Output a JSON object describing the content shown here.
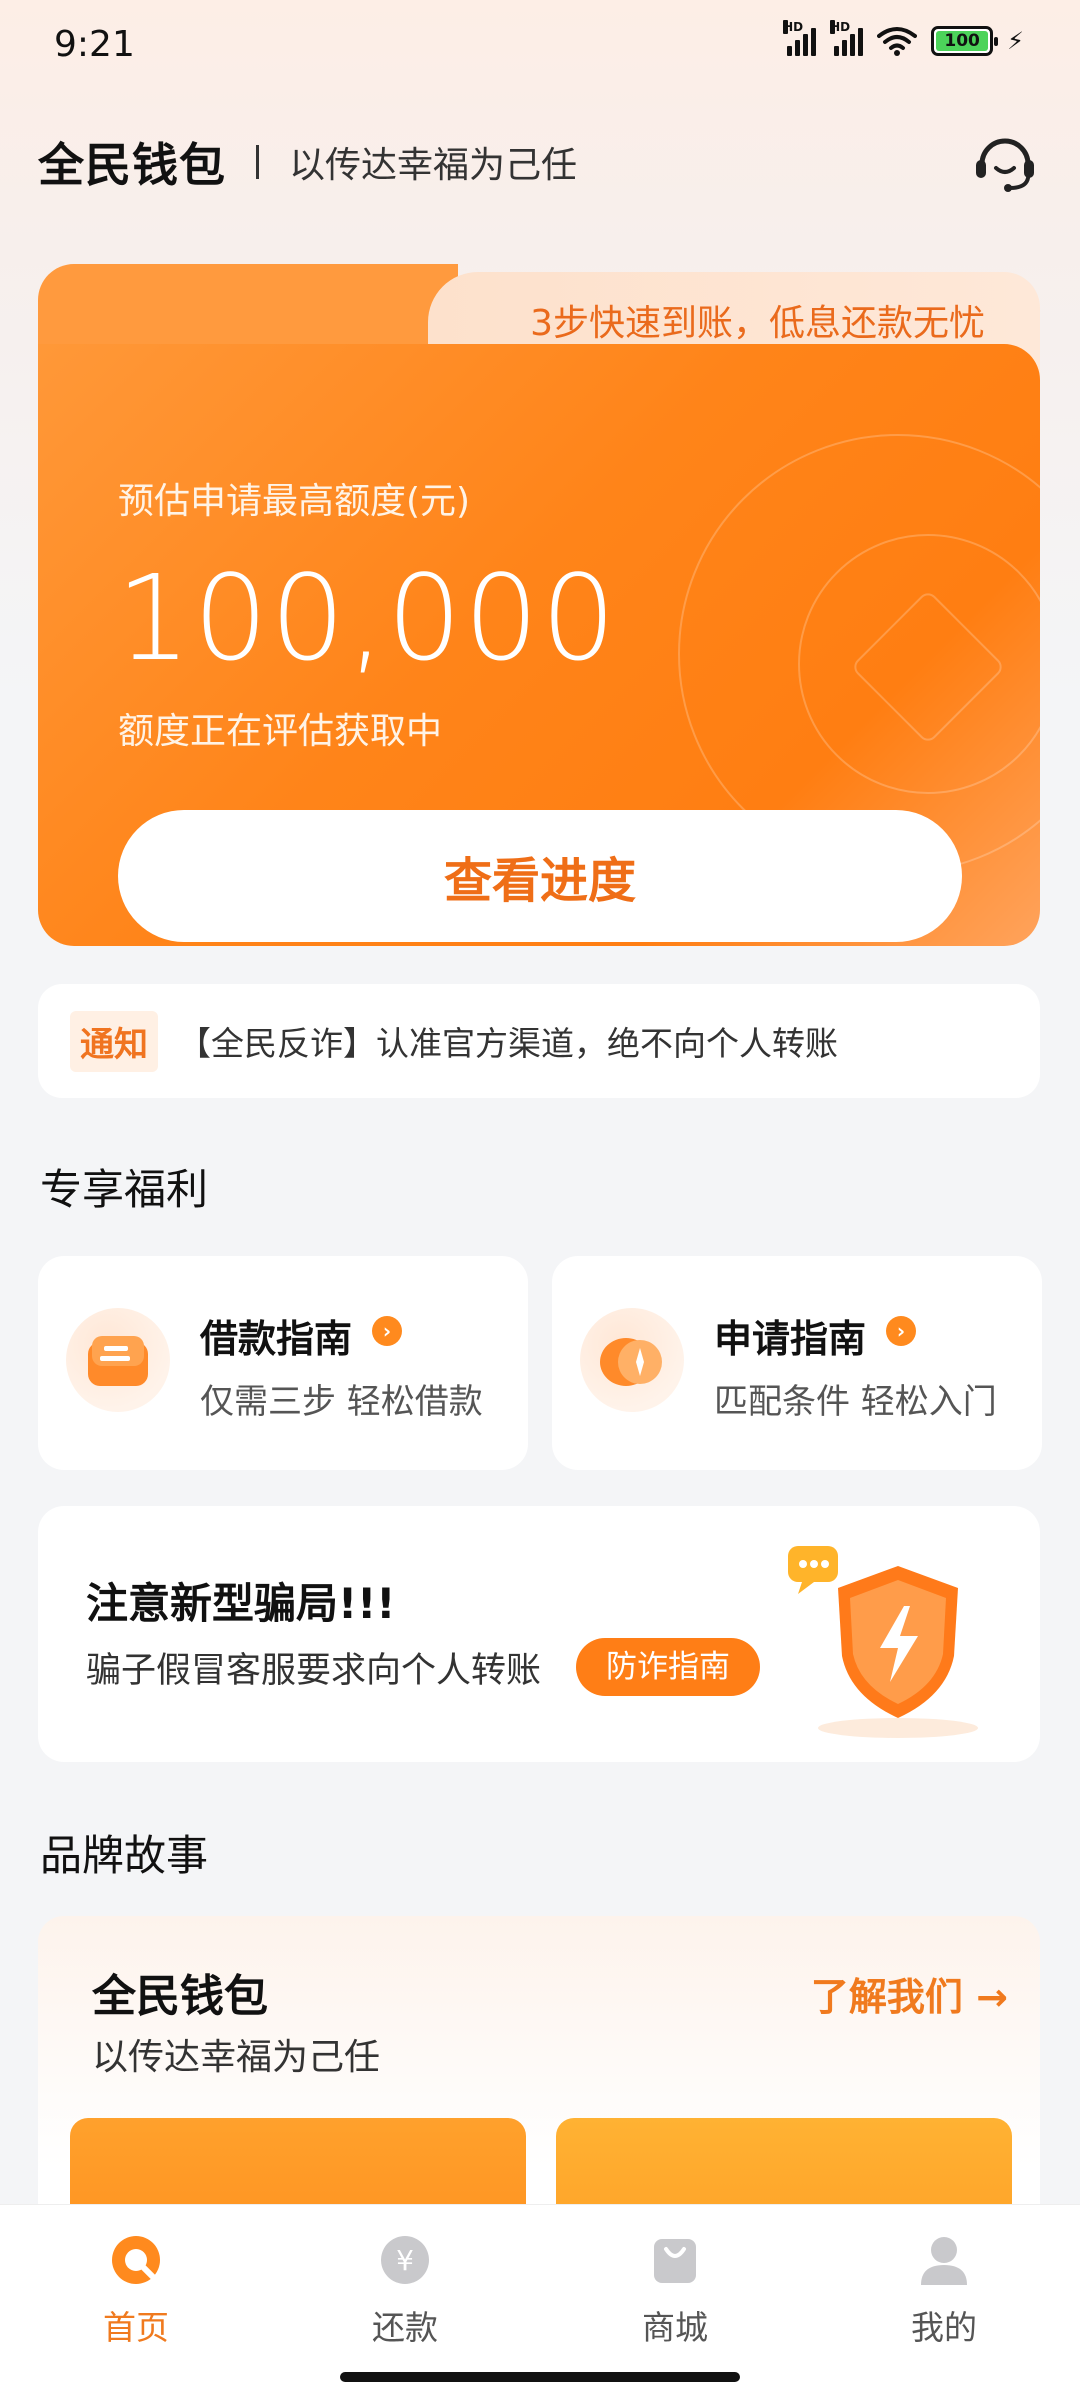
{
  "status_bar": {
    "time": "9:21",
    "network_1": "HD",
    "network_2": "HD",
    "battery_level": "100"
  },
  "header": {
    "brand": "全民钱包",
    "slogan": "以传达幸福为己任"
  },
  "credit_card": {
    "tab_text": "3步快速到账，低息还款无忧",
    "label": "预估申请最高额度(元)",
    "amount": "100,000",
    "status": "额度正在评估获取中",
    "button_label": "查看进度"
  },
  "notice": {
    "tag": "通知",
    "text": "【全民反诈】认准官方渠道，绝不向个人转账"
  },
  "benefits": {
    "section_title": "专享福利",
    "items": [
      {
        "title": "借款指南",
        "subtitle": "仅需三步 轻松借款"
      },
      {
        "title": "申请指南",
        "subtitle": "匹配条件 轻松入门"
      }
    ]
  },
  "fraud_banner": {
    "title": "注意新型骗局!!!",
    "subtitle": "骗子假冒客服要求向个人转账",
    "button_label": "防诈指南"
  },
  "brand_story": {
    "section_title": "品牌故事",
    "title": "全民钱包",
    "subtitle": "以传达幸福为己任",
    "link_label": "了解我们 →"
  },
  "bottom_nav": {
    "items": [
      {
        "label": "首页",
        "icon": "home-icon",
        "active": true
      },
      {
        "label": "还款",
        "icon": "yuan-icon",
        "active": false
      },
      {
        "label": "商城",
        "icon": "shopping-bag-icon",
        "active": false
      },
      {
        "label": "我的",
        "icon": "user-icon",
        "active": false
      }
    ]
  },
  "colors": {
    "accent": "#ff7e16",
    "accent_text": "#f07a1e",
    "background": "#f4f5f7"
  }
}
